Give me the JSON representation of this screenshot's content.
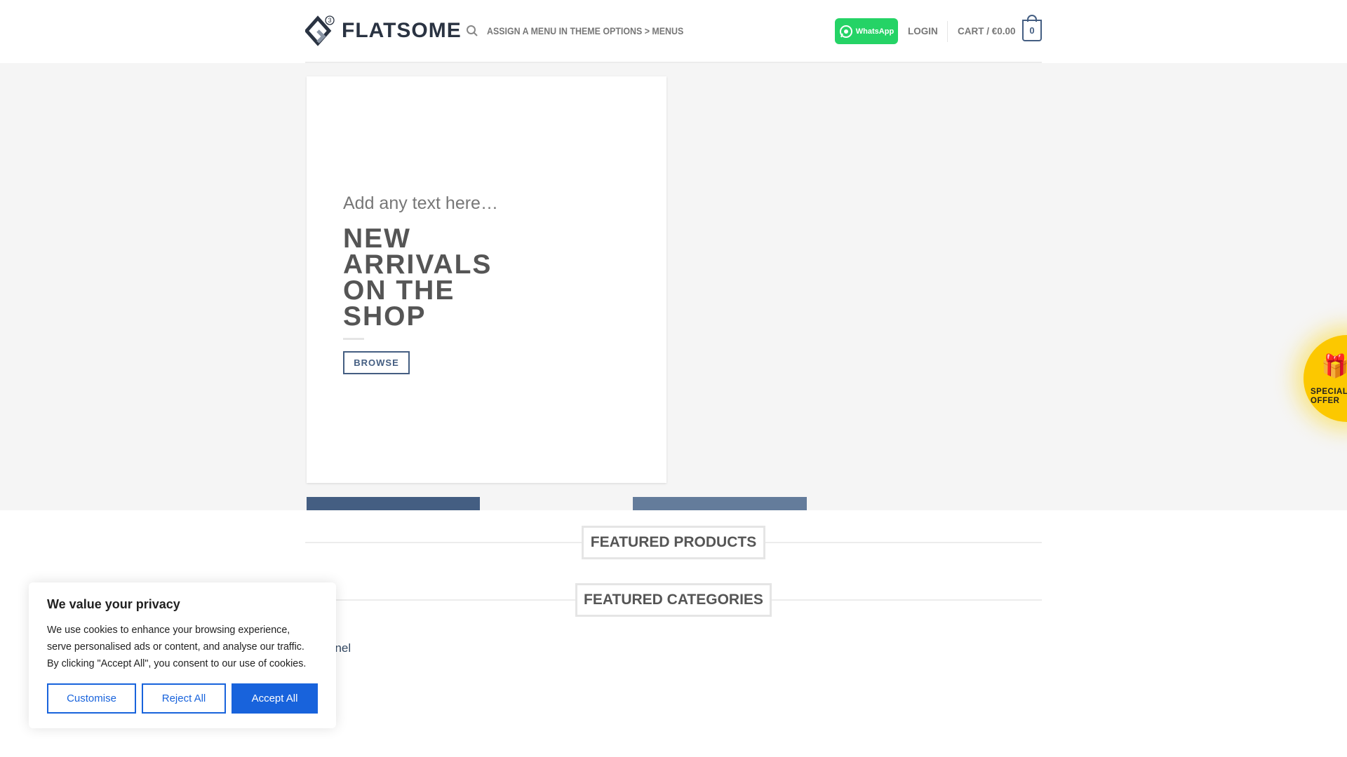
{
  "header": {
    "logo_text": "FLATSOME",
    "logo_badge": "3",
    "menu_text": "ASSIGN A MENU IN THEME OPTIONS > MENUS",
    "whatsapp_label": "WhatsApp",
    "login": "LOGIN",
    "cart_label": "CART / €0.00",
    "cart_count": "0"
  },
  "hero": {
    "tagline": "Add any text here…",
    "heading": "NEW ARRIVALS ON THE SHOP",
    "button": "BROWSE"
  },
  "sections": {
    "featured_products": "FEATURED PRODUCTS",
    "featured_categories": "FEATURED CATEGORIES",
    "partial_text": "anel"
  },
  "special_offer": {
    "label": "SPECIAL OFFER"
  },
  "cookie": {
    "title": "We value your privacy",
    "body": "We use cookies to enhance your browsing experience, serve personalised ads or content, and analyse our traffic. By clicking \"Accept All\", you consent to our use of cookies.",
    "customise": "Customise",
    "reject": "Reject All",
    "accept": "Accept All"
  },
  "colors": {
    "primary": "#445e82",
    "whatsapp": "#25d366",
    "cookie_blue": "#1863dc",
    "offer": "#fcc800"
  }
}
